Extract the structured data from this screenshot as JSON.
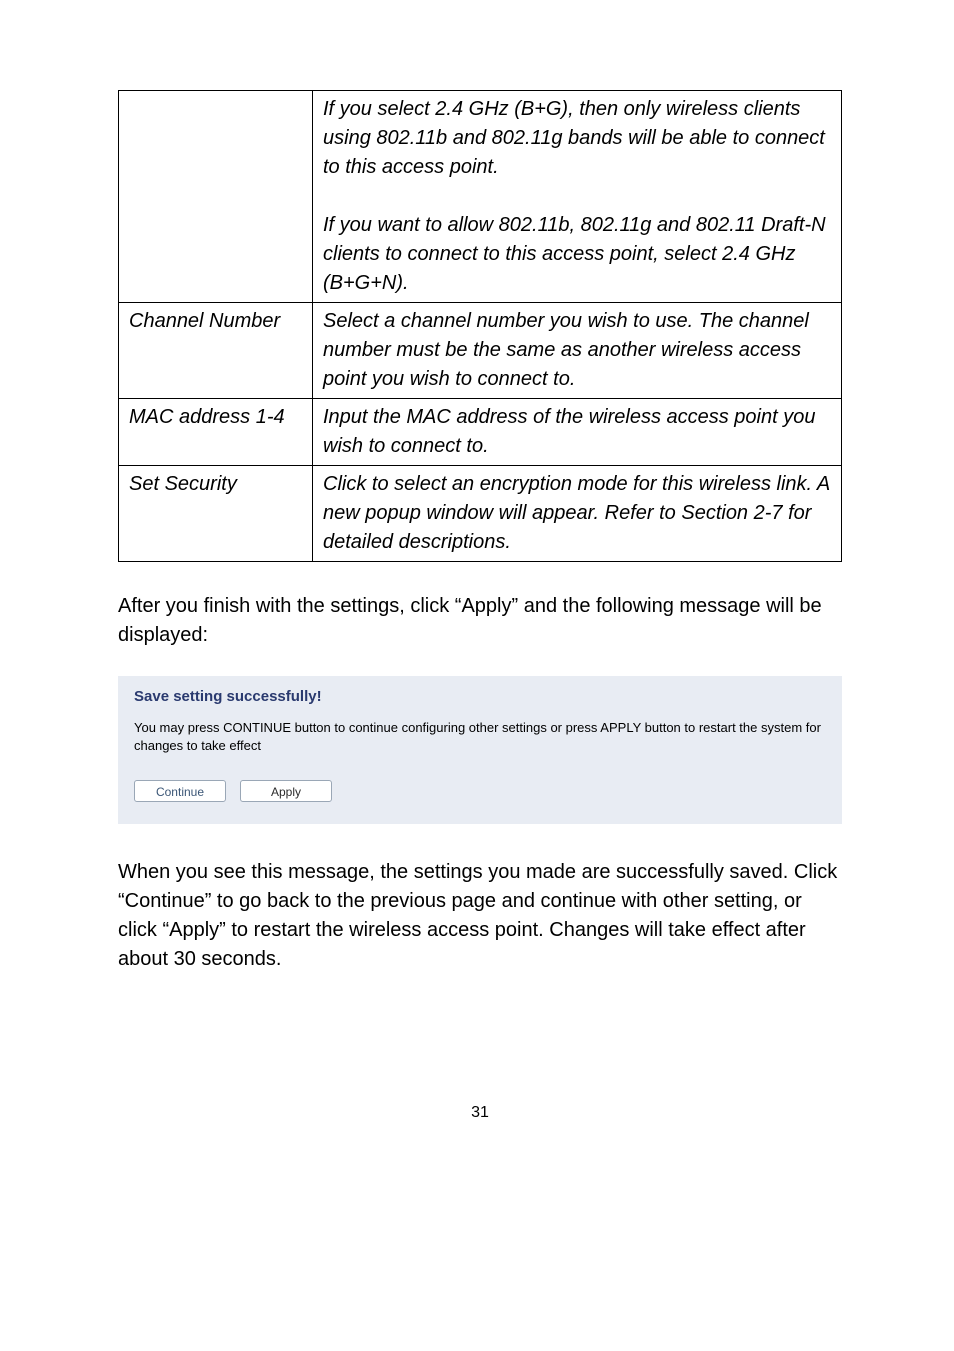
{
  "table_rows": [
    {
      "label": "",
      "desc": "If you select 2.4 GHz (B+G), then only wireless clients using 802.11b and 802.11g bands will be able to connect to this access point.\n\nIf you want to allow 802.11b, 802.11g and 802.11 Draft-N clients to connect to this access point, select 2.4 GHz (B+G+N)."
    },
    {
      "label": "Channel Number",
      "desc": "Select a channel number you wish to use. The channel number must be the same as another wireless access point you wish to connect to."
    },
    {
      "label": "MAC address 1-4",
      "desc": "Input the MAC address of the wireless access point you wish to connect to."
    },
    {
      "label": "Set Security",
      "desc": "Click to select an encryption mode for this wireless link. A new popup window will appear. Refer to Section 2-7 for detailed descriptions."
    }
  ],
  "para1": "After you finish with the settings, click “Apply” and the following message will be displayed:",
  "panel": {
    "title": "Save setting successfully!",
    "msg": "You may press CONTINUE button to continue configuring other settings or press APPLY button to restart the system for changes to take effect",
    "continue_label": "Continue",
    "apply_label": "Apply"
  },
  "para2": "When you see this message, the settings you made are successfully saved. Click “Continue” to go back to the previous page and continue with other setting, or click “Apply” to restart the wireless access point. Changes will take effect after about 30 seconds.",
  "page_number": "31"
}
